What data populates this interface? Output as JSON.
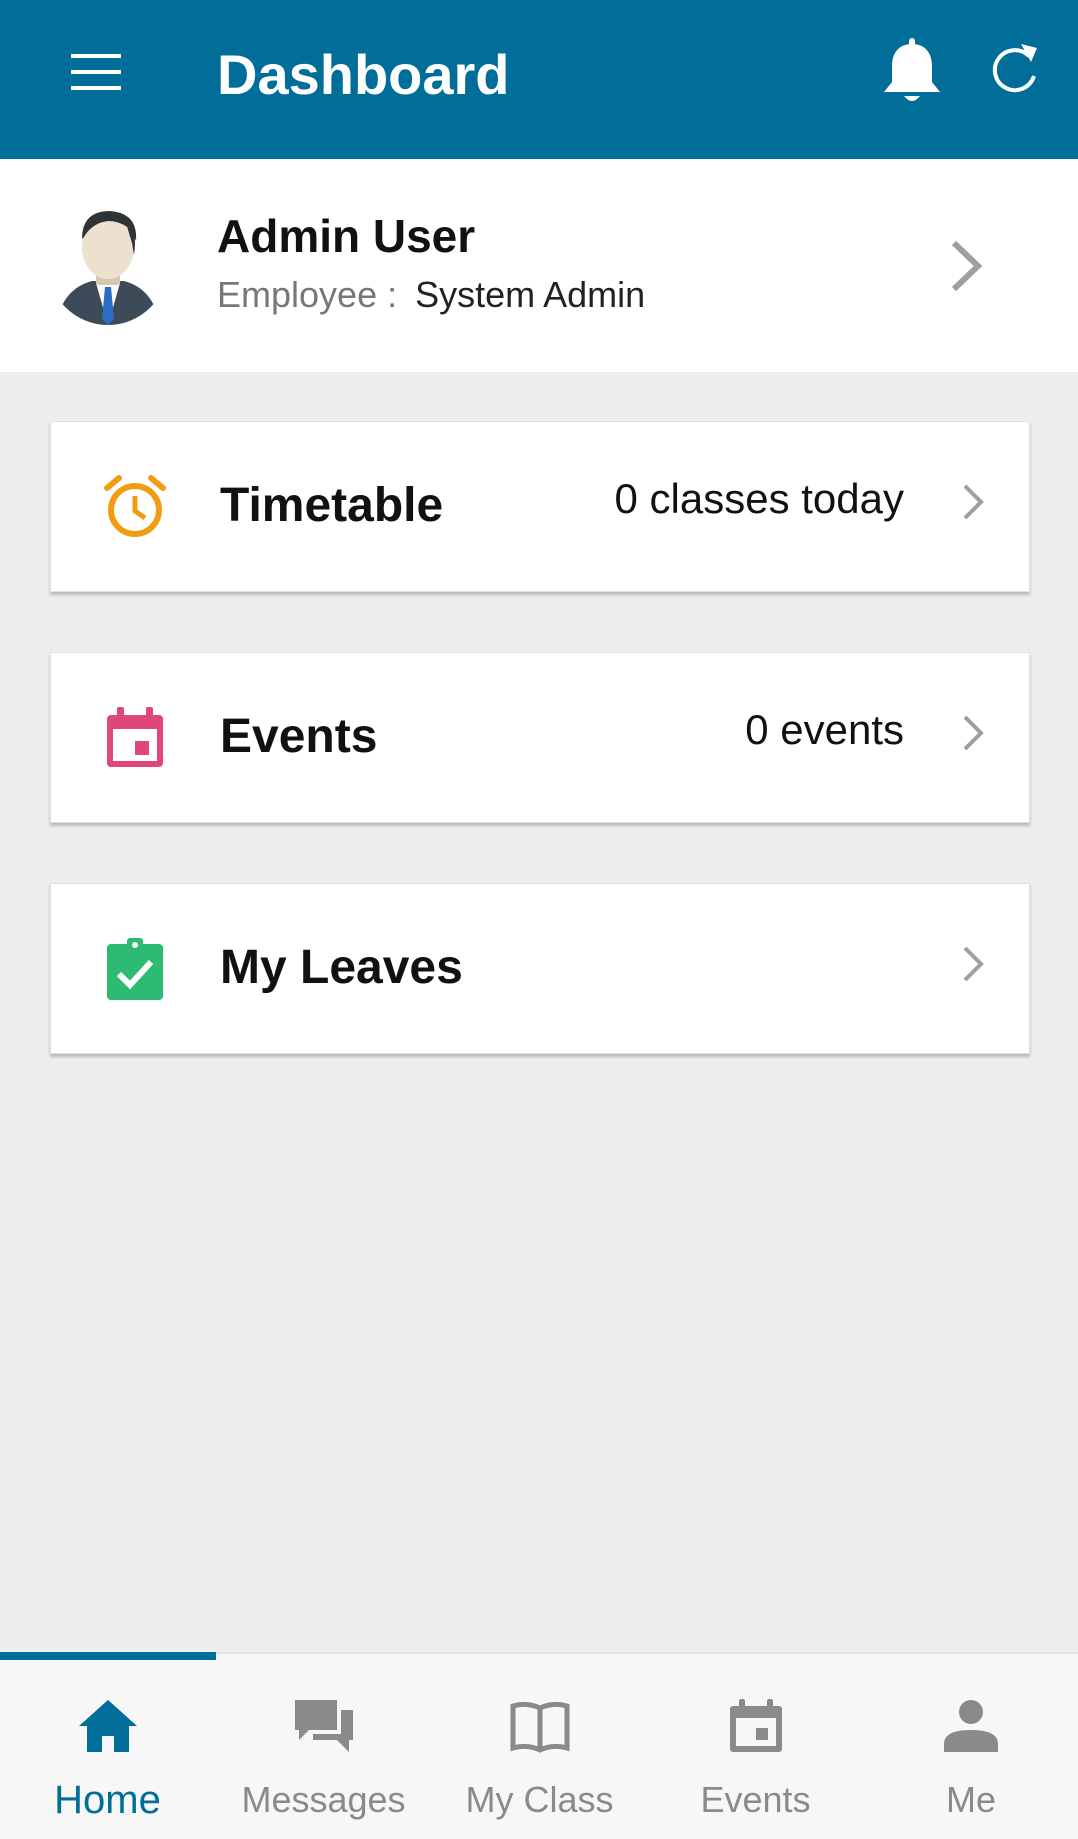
{
  "appbar": {
    "title": "Dashboard",
    "menu_icon": "hamburger-menu-icon",
    "bell_icon": "bell-icon",
    "refresh_icon": "refresh-icon",
    "background": "#006e98"
  },
  "profile": {
    "name": "Admin User",
    "role_label": "Employee :",
    "role_value": "System Admin",
    "avatar_icon": "user-avatar",
    "chevron_icon": "chevron-right-icon"
  },
  "cards": [
    {
      "title": "Timetable",
      "value": "0 classes today",
      "icon": "alarm-clock-icon",
      "icon_color": "#f39c12"
    },
    {
      "title": "Events",
      "value": "0 events",
      "icon": "calendar-event-icon",
      "icon_color": "#e0457b"
    },
    {
      "title": "My Leaves",
      "value": "",
      "icon": "clipboard-check-icon",
      "icon_color": "#2dbb74"
    }
  ],
  "bottom_nav": [
    {
      "label": "Home",
      "icon": "home-icon",
      "active": true
    },
    {
      "label": "Messages",
      "icon": "messages-icon",
      "active": false
    },
    {
      "label": "My Class",
      "icon": "book-icon",
      "active": false
    },
    {
      "label": "Events",
      "icon": "calendar-icon",
      "active": false
    },
    {
      "label": "Me",
      "icon": "person-icon",
      "active": false
    }
  ],
  "colors": {
    "accent": "#006e98",
    "inactive": "#8a8a8a",
    "background": "#eeeeee"
  }
}
